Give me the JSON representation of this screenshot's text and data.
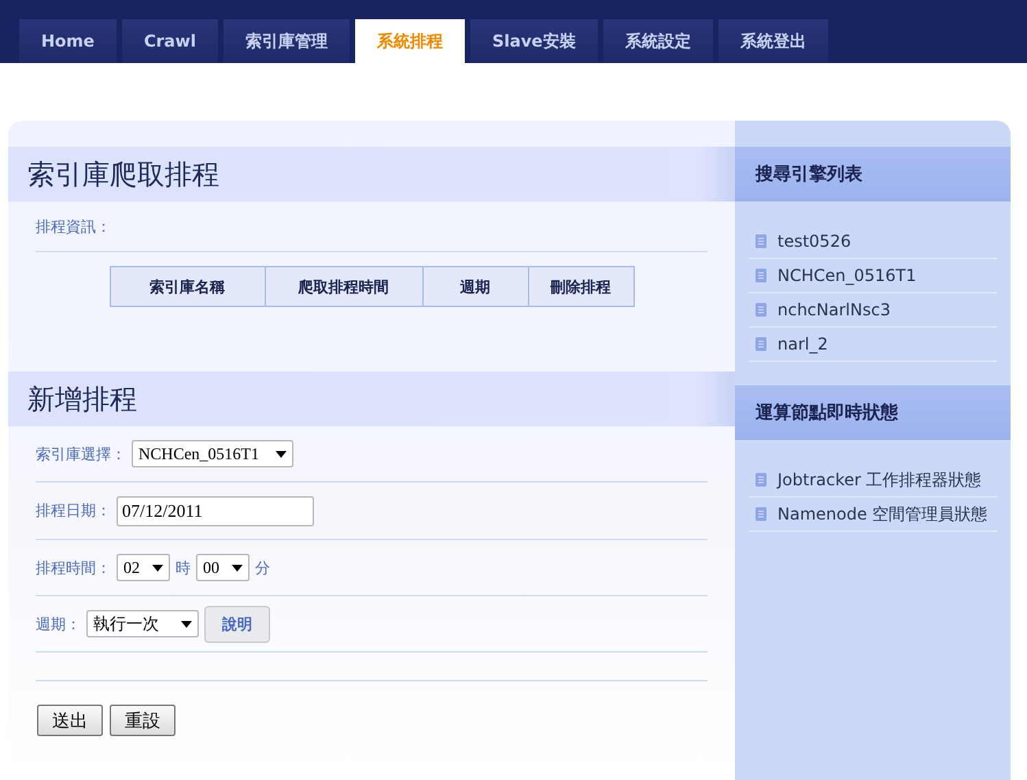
{
  "nav": {
    "tabs": [
      {
        "label": "Home",
        "selected": false
      },
      {
        "label": "Crawl",
        "selected": false
      },
      {
        "label": "索引庫管理",
        "selected": false
      },
      {
        "label": "系統排程",
        "selected": true
      },
      {
        "label": "Slave安裝",
        "selected": false
      },
      {
        "label": "系統設定",
        "selected": false
      },
      {
        "label": "系統登出",
        "selected": false
      }
    ]
  },
  "schedule": {
    "title": "索引庫爬取排程",
    "info_label": "排程資訊：",
    "table": {
      "columns": [
        "索引庫名稱",
        "爬取排程時間",
        "週期",
        "刪除排程"
      ]
    }
  },
  "new_schedule": {
    "title": "新增排程",
    "index_label": "索引庫選擇：",
    "index_value": "NCHCen_0516T1",
    "date_label": "排程日期：",
    "date_value": "07/12/2011",
    "time_label": "排程時間：",
    "hour_value": "02",
    "hour_unit": "時",
    "minute_value": "00",
    "minute_unit": "分",
    "period_label": "週期：",
    "period_value": "執行一次",
    "help_button": "說明",
    "buttons": [
      "送出",
      "重設"
    ]
  },
  "sidebar": {
    "sections": [
      {
        "title": "搜尋引擎列表",
        "items": [
          "test0526",
          "NCHCen_0516T1",
          "nchcNarlNsc3",
          "narl_2"
        ]
      },
      {
        "title": "運算節點即時狀態",
        "items": [
          "Jobtracker 工作排程器狀態",
          "Namenode 空間管理員狀態"
        ]
      }
    ]
  }
}
